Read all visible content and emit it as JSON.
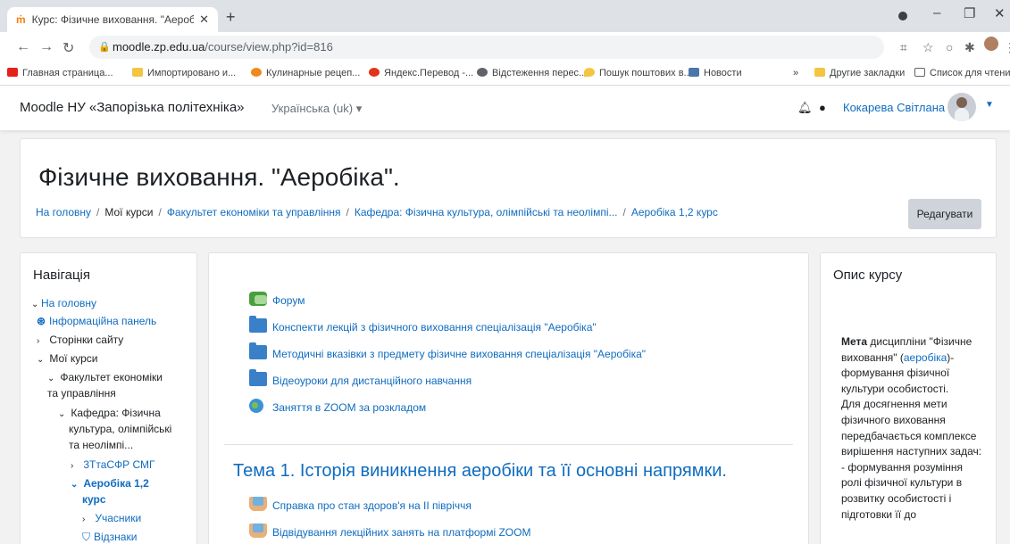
{
  "browser": {
    "tab_title": "Курс: Фізичне виховання. \"Аероб",
    "new_tab": "+",
    "url_host": "moodle.zp.edu.ua",
    "url_path": "/course/view.php?id=816",
    "bookmarks": [
      "Главная страница...",
      "Импортировано и...",
      "Кулинарные рецеп...",
      "Яндекс.Перевод -...",
      "Відстеження перес...",
      "Пошук поштових в...",
      "Новости"
    ],
    "bookmarks_more": "»",
    "other_bookmarks": "Другие закладки",
    "reading_list": "Список для чтения",
    "icons": {
      "back": "arrow-left-icon",
      "forward": "arrow-right-icon",
      "reload": "reload-icon",
      "lock": "lock-icon",
      "translate": "translate-icon",
      "star": "star-icon",
      "extension": "puzzle-icon",
      "menu": "kebab-menu-icon"
    }
  },
  "navbar": {
    "site_name": "Moodle НУ «Запорізька політехніка»",
    "language": "Українська (uk) ▾",
    "user_name": "Кокарева Світлана"
  },
  "header": {
    "title": "Фізичне виховання. \"Аеробіка\".",
    "breadcrumb": [
      "На головну",
      "Мої курси",
      "Факультет економіки та управління",
      "Кафедра: Фізична культура, олімпійські та неолімпі...",
      "Аеробіка 1,2 курс"
    ],
    "edit_button": "Редагувати"
  },
  "navigation": {
    "title": "Навігація",
    "items": [
      "На головну",
      "Інформаційна панель",
      "Сторінки сайту",
      "Мої курси",
      "Факультет економіки",
      "та управління",
      "Кафедра: Фізична",
      "культура, олімпійські",
      "та неолімпі...",
      "3ТтаСФР СМГ",
      "Аеробіка 1,2",
      "курс",
      "Учасники",
      "Відзнаки"
    ]
  },
  "main": {
    "activities": [
      "Форум",
      "Конспекти лекцій з фізичного виховання спеціалізація \"Аеробіка\"",
      "Методичні вказівки з предмету фізичне виховання спеціалізація \"Аеробіка\"",
      "Відеоуроки для дистанційного навчання",
      "Заняття в ZOOM за розкладом"
    ],
    "topic_title": "Тема 1. Історія виникнення аеробіки та її основні напрямки.",
    "topic_activities": [
      "Справка про стан здоров'я на ІІ півріччя",
      "Відвідування лекційних занять на платформі ZOOM"
    ]
  },
  "course_description": {
    "title": "Опис курсу",
    "text_bold": "Мета",
    "text_1": " дисципліни \"Фізичне виховання\" (",
    "text_link": "аеробіка",
    "text_2": ")- формування фізичної культури особистості.",
    "text_3": "Для досягнення мети фізичного виховання передбачається комплексе вирішення наступних задач:",
    "text_4": "- формування розуміння ролі фізичної культури в розвитку особистості і підготовки її до"
  },
  "colors": {
    "link": "#0f6cbf",
    "page_bg": "#f2f2f2",
    "moodle_orange": "#f98012"
  }
}
